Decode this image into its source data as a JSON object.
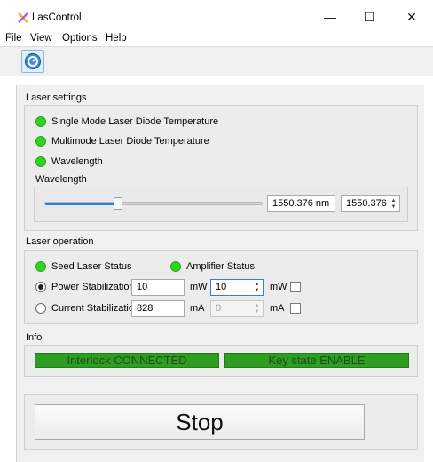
{
  "window": {
    "title": "LasControl",
    "minimize": "—",
    "maximize": "☐",
    "close": "✕"
  },
  "menu": [
    "File",
    "View",
    "Options",
    "Help"
  ],
  "colors": {
    "led_on": "#2ed51f",
    "status_bg": "#2e9e22",
    "status_text": "#1e4d17",
    "accent": "#2f7fd3"
  },
  "laser_settings": {
    "title": "Laser settings",
    "indicators": [
      {
        "label": "Single Mode Laser Diode Temperature",
        "state": "on"
      },
      {
        "label": "Multimode Laser Diode Temperature",
        "state": "on"
      },
      {
        "label": "Wavelength",
        "state": "on"
      }
    ],
    "wavelength": {
      "label": "Wavelength",
      "slider_fraction": 0.33,
      "display": "1550.376 nm",
      "spin_value": "1550.376"
    }
  },
  "laser_operation": {
    "title": "Laser operation",
    "seed_label": "Seed Laser Status",
    "amp_label": "Amplifier Status",
    "power": {
      "label": "Power Stabilization",
      "selected": true,
      "value": "10",
      "unit": "mW",
      "spin_value": "10",
      "spin_unit": "mW"
    },
    "current": {
      "label": "Current Stabilization",
      "selected": false,
      "value": "828",
      "unit": "mA",
      "spin_value": "0",
      "spin_unit": "mA"
    }
  },
  "info": {
    "title": "Info",
    "interlock": "Interlock CONNECTED",
    "key_state": "Key state ENABLE"
  },
  "stop_button": "Stop"
}
